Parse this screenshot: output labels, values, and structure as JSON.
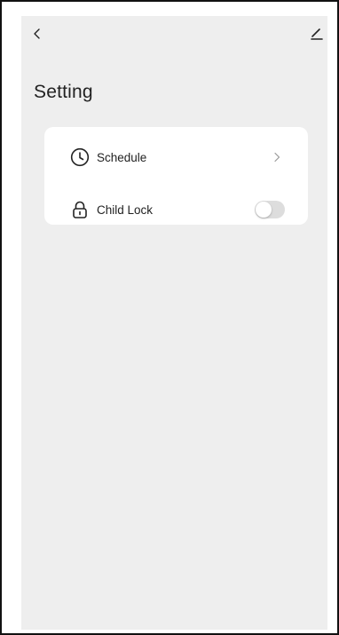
{
  "page": {
    "title": "Setting"
  },
  "settings": {
    "items": [
      {
        "label": "Schedule",
        "icon": "clock-icon",
        "accessory": "chevron"
      },
      {
        "label": "Child Lock",
        "icon": "lock-icon",
        "accessory": "toggle",
        "toggle_on": false
      }
    ]
  },
  "colors": {
    "background": "#eeeeee",
    "card": "#ffffff",
    "toggle_off": "#dddddd",
    "text": "#222222"
  }
}
